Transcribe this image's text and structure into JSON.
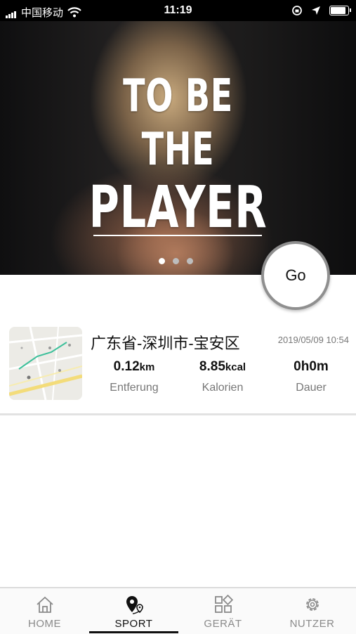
{
  "status_bar": {
    "carrier": "中国移动",
    "time": "11:19"
  },
  "banner": {
    "line1": "TO BE",
    "line2": "THE",
    "line3": "PLAYER",
    "slide_count": 3,
    "active_slide": 1
  },
  "go_button": {
    "label": "Go"
  },
  "record": {
    "location": "广东省-深圳市-宝安区",
    "datetime": "2019/05/09 10:54",
    "distance": {
      "value": "0.12",
      "unit": "km",
      "label": "Entferung"
    },
    "calories": {
      "value": "8.85",
      "unit": "kcal",
      "label": "Kalorien"
    },
    "duration": {
      "value": "0h0m",
      "label": "Dauer"
    }
  },
  "tabs": [
    {
      "label": "HOME",
      "icon": "home-icon"
    },
    {
      "label": "SPORT",
      "icon": "location-pin-icon",
      "active": true
    },
    {
      "label": "GERÄT",
      "icon": "grid-icon"
    },
    {
      "label": "NUTZER",
      "icon": "gear-icon"
    }
  ]
}
